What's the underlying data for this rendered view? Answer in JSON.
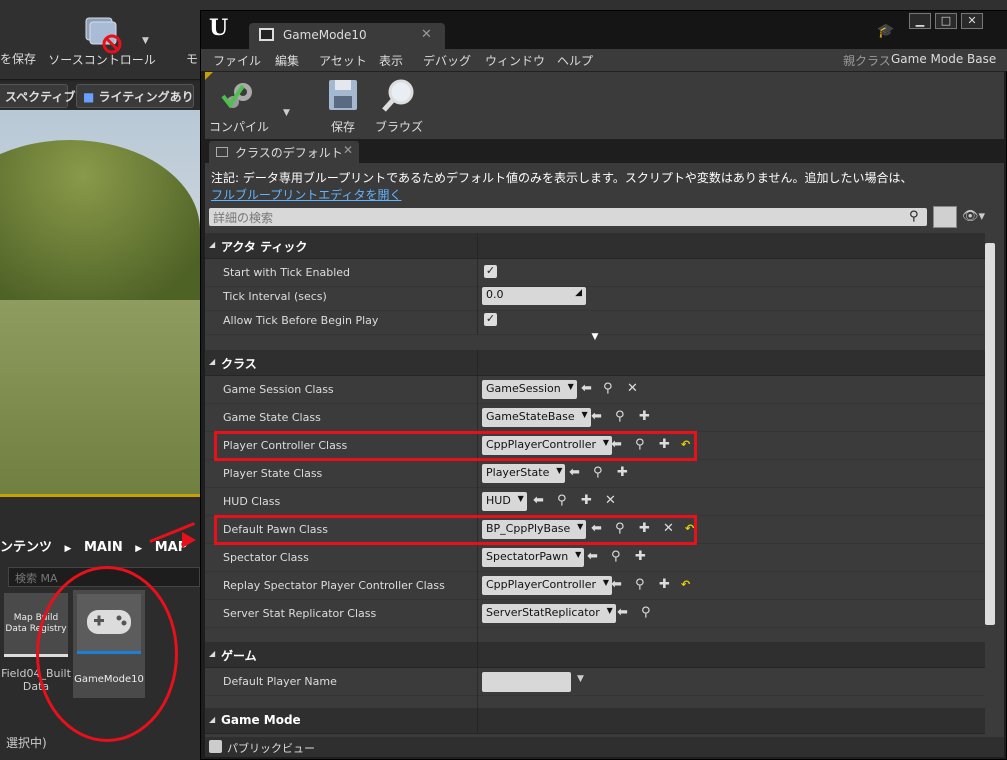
{
  "background_editor": {
    "save_label": "を保存",
    "source_control_label": "ソースコントロール",
    "mode_label": "モ",
    "perspective_label": "スペクティブ",
    "lighting_label": "ライティングあり",
    "breadcrumb": [
      "ンテンツ",
      "MAIN",
      "MAP"
    ],
    "search_placeholder": "検索 MA",
    "asset1": {
      "thumb_text": "Map Build Data Registry",
      "label": "Field04_Built Data"
    },
    "asset2": {
      "label": "GameMode10"
    },
    "selection_text": "選択中)"
  },
  "window": {
    "logo": "U",
    "tab_title": "GameMode10",
    "menu": [
      "ファイル",
      "編集",
      "アセット",
      "表示",
      "デバッグ",
      "ウィンドウ",
      "ヘルプ"
    ],
    "parent_class_label": "親クラス",
    "parent_class_value": "Game Mode Base",
    "toolbar": {
      "compile": "コンパイル",
      "save": "保存",
      "browse": "ブラウズ"
    },
    "panel_tab": "クラスのデフォルト",
    "note": "注記:  データ専用ブループリントであるためデフォルト値のみを表示します。スクリプトや変数はありません。追加したい場合は、",
    "note_link": "フルブループリントエディタを開く",
    "search_placeholder": "詳細の検索",
    "footer_label": "パブリックビュー"
  },
  "categories": {
    "actor_tick": "アクタ ティック",
    "classes": "クラス",
    "game": "ゲーム",
    "game_mode": "Game Mode"
  },
  "tick_rows": [
    {
      "name": "Start with Tick Enabled",
      "checked": true
    },
    {
      "name": "Tick Interval (secs)",
      "value": "0.0"
    },
    {
      "name": "Allow Tick Before Begin Play",
      "checked": true
    }
  ],
  "class_rows": [
    {
      "name": "Game Session Class",
      "value": "GameSession"
    },
    {
      "name": "Game State Class",
      "value": "GameStateBase"
    },
    {
      "name": "Player Controller Class",
      "value": "CppPlayerController"
    },
    {
      "name": "Player State Class",
      "value": "PlayerState"
    },
    {
      "name": "HUD Class",
      "value": "HUD"
    },
    {
      "name": "Default Pawn Class",
      "value": "BP_CppPlyBase"
    },
    {
      "name": "Spectator Class",
      "value": "SpectatorPawn"
    },
    {
      "name": "Replay Spectator Player Controller Class",
      "value": "CppPlayerController"
    },
    {
      "name": "Server Stat Replicator Class",
      "value": "ServerStatReplicator"
    }
  ],
  "game_rows": [
    {
      "name": "Default Player Name",
      "value": ""
    }
  ],
  "colors": {
    "annotation_red": "#e8101a",
    "link_blue": "#63b4ff",
    "accent_gold": "#c9a000"
  }
}
